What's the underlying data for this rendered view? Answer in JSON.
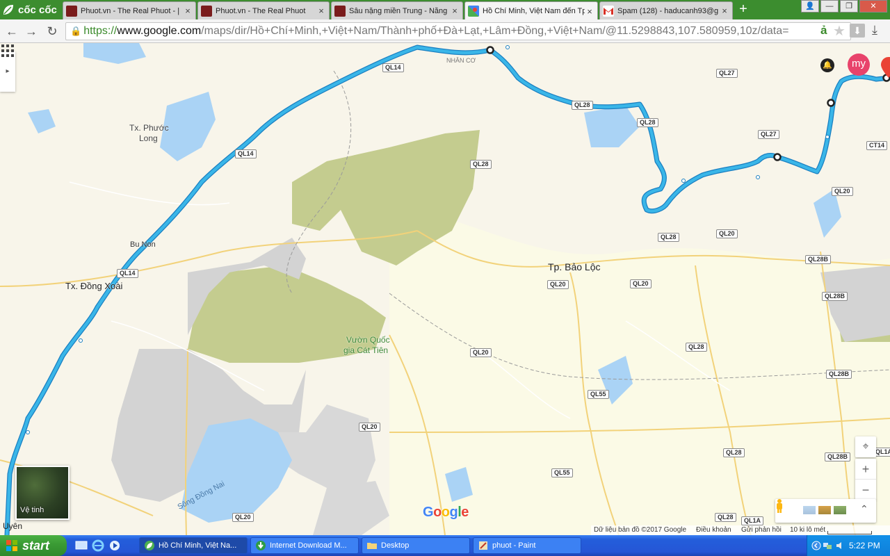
{
  "browser": {
    "logo_text": "cốc cốc",
    "tabs": [
      {
        "title": "Phuot.vn - The Real Phuot - |",
        "favicon": "phuot-icon",
        "active": false
      },
      {
        "title": "Phuot.vn - The Real Phuot",
        "favicon": "phuot-icon",
        "active": false
      },
      {
        "title": "Sâu nặng miền Trung - Nẵng",
        "favicon": "phuot-icon",
        "active": false
      },
      {
        "title": "Hồ Chí Minh, Việt Nam đến Tp",
        "favicon": "google-maps-icon",
        "active": true
      },
      {
        "title": "Spam (128) - haducanh93@g",
        "favicon": "gmail-icon",
        "active": false
      }
    ],
    "tab_close": "×",
    "new_tab": "+",
    "window_controls": {
      "user": "👤",
      "minimize": "—",
      "restore": "❐",
      "close": "✕"
    },
    "nav": {
      "back": "←",
      "forward": "→",
      "reload": "↻"
    },
    "address": {
      "scheme": "https://",
      "host": "www.google.com",
      "path": "/maps/dir/Hồ+Chí+Minh,+Việt+Nam/Thành+phố+Đà+Lạt,+Lâm+Đồng,+Việt+Nam/@11.5298843,107.580959,10z/data=",
      "lang_indicator": "ả"
    }
  },
  "map": {
    "place_labels": {
      "phuoc_long": "Tx. Phước",
      "phuoc_long_2": "Long",
      "bu_non": "Bu Non",
      "dong_xoai": "Tx. Đồng Xoài",
      "bao_loc": "Tp. Bảo Lộc",
      "cat_tien": "Vườn Quốc",
      "cat_tien_2": "gia Cát Tiên",
      "dong_nai_river": "Sông Đồng Nai",
      "nhan_co": "NHÂN CƠ",
      "uyen": "Uyên"
    },
    "road_labels": [
      "QL14",
      "QL14",
      "QL14",
      "QL28",
      "QL28",
      "QL28",
      "QL28",
      "QL27",
      "QL27",
      "CT14",
      "QL20",
      "QL20",
      "QL20",
      "QL20",
      "QL20",
      "QL20",
      "QL28B",
      "QL28B",
      "QL28B",
      "QL28B",
      "QL28",
      "QL55",
      "QL55",
      "QL28",
      "QL1A",
      "QL1A",
      "QL28",
      "QL20"
    ],
    "controls": {
      "side_toggle": "▸",
      "apps_icon": "apps-grid-icon",
      "notification": "🔔",
      "avatar_text": "my",
      "satellite_label": "Vệ tinh",
      "zoom_in": "+",
      "zoom_out": "−",
      "locate": "⌖",
      "expand": "⌃"
    },
    "google_logo": "Google",
    "footer": {
      "data_credit": "Dữ liệu bản đồ ©2017 Google",
      "terms": "Điều khoản",
      "feedback": "Gửi phản hồi",
      "scale": "10 ki lô mét"
    },
    "route_color": "#3ab6e8"
  },
  "taskbar": {
    "start_label": "start",
    "buttons": [
      {
        "label": "Hồ Chí Minh, Việt Na...",
        "icon": "coccoc-icon",
        "active": true
      },
      {
        "label": "Internet Download M...",
        "icon": "idm-icon",
        "active": false
      },
      {
        "label": "Desktop",
        "icon": "folder-icon",
        "active": false
      },
      {
        "label": "phuot - Paint",
        "icon": "paint-icon",
        "active": false
      }
    ],
    "clock": "5:22 PM"
  }
}
